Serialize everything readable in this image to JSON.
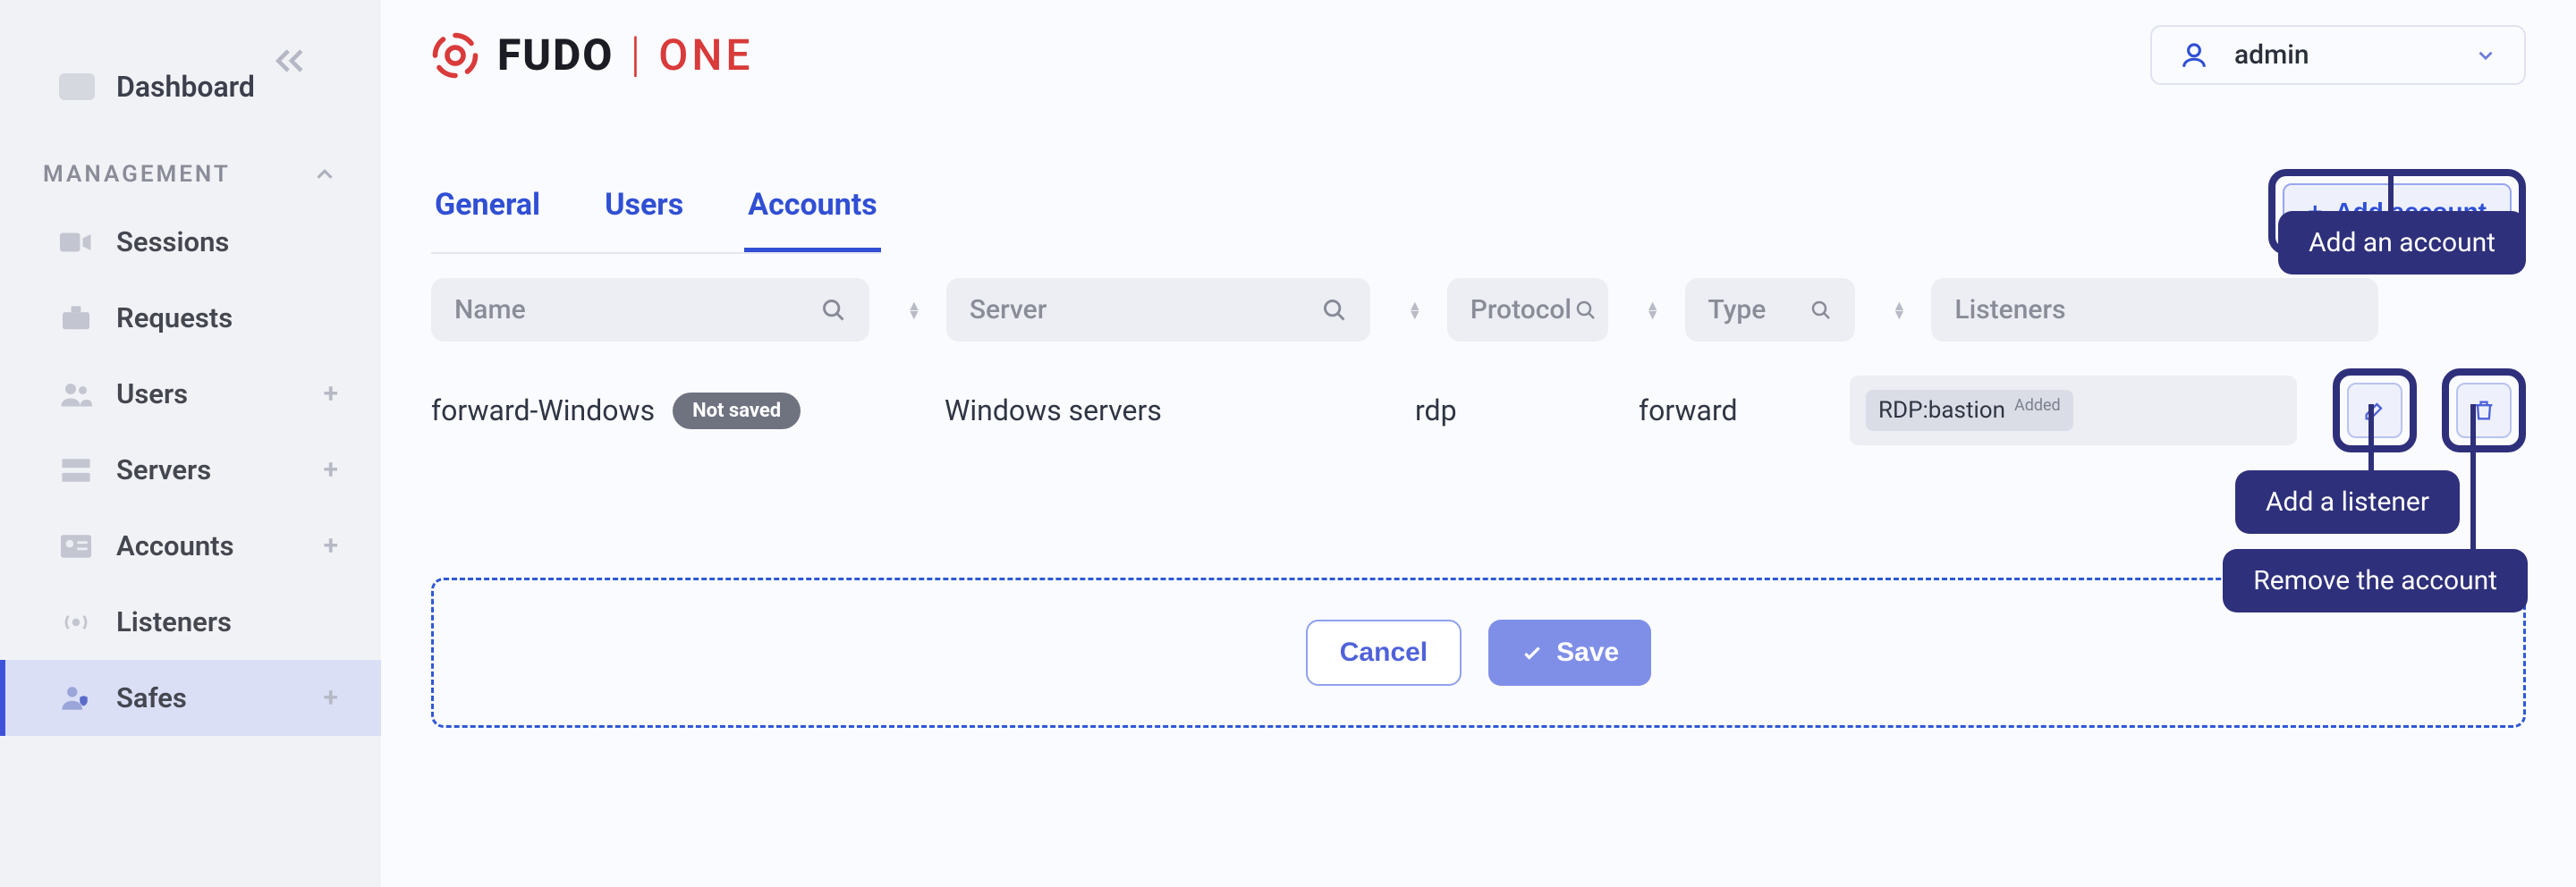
{
  "brand": {
    "name": "FUDO",
    "variant": "ONE"
  },
  "user": {
    "name": "admin"
  },
  "sidebar": {
    "dashboard": "Dashboard",
    "group_label": "MANAGEMENT",
    "items": [
      {
        "label": "Sessions",
        "plus": false
      },
      {
        "label": "Requests",
        "plus": false
      },
      {
        "label": "Users",
        "plus": true
      },
      {
        "label": "Servers",
        "plus": true
      },
      {
        "label": "Accounts",
        "plus": true
      },
      {
        "label": "Listeners",
        "plus": false
      },
      {
        "label": "Safes",
        "plus": true,
        "active": true
      }
    ]
  },
  "tabs": {
    "items": [
      "General",
      "Users",
      "Accounts"
    ],
    "active": 2
  },
  "add_button": {
    "label": "Add account"
  },
  "filters": {
    "name": "Name",
    "server": "Server",
    "protocol": "Protocol",
    "type": "Type",
    "listeners": "Listeners"
  },
  "row": {
    "name": "forward-Windows",
    "badge": "Not saved",
    "server": "Windows servers",
    "protocol": "rdp",
    "type": "forward",
    "listener": {
      "label": "RDP:bastion",
      "status": "Added"
    }
  },
  "footer": {
    "cancel": "Cancel",
    "save": "Save"
  },
  "callouts": {
    "add_account": "Add an account",
    "add_listener": "Add a listener",
    "remove_account": "Remove the account"
  }
}
